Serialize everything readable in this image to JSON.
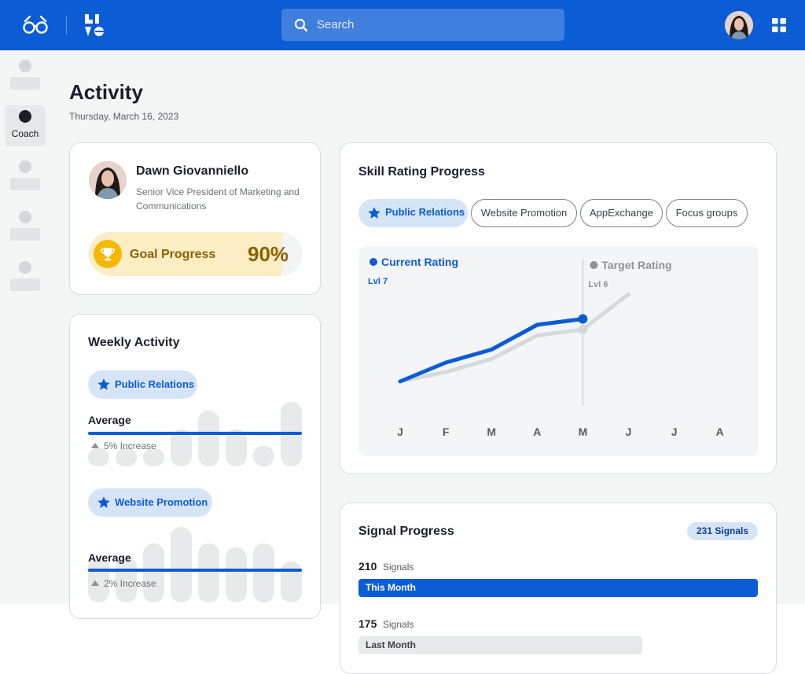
{
  "header": {
    "search_placeholder": "Search",
    "brand_color": "#0b5cd5",
    "icons": [
      "glasses-logo-icon",
      "live-logo-icon",
      "search-icon",
      "apps-grid-icon"
    ]
  },
  "sidebar": {
    "items": [
      {
        "label": ""
      },
      {
        "label": "Coach",
        "active": true
      },
      {
        "label": ""
      },
      {
        "label": ""
      },
      {
        "label": ""
      }
    ]
  },
  "page": {
    "title": "Activity",
    "date": "Thursday, March 16, 2023"
  },
  "profile": {
    "name": "Dawn Giovanniello",
    "role": "Senior Vice President of Marketing and Communications",
    "goal_label": "Goal Progress",
    "goal_value": "90%",
    "goal_fraction": 0.9,
    "goal_color": "#f5b800"
  },
  "weekly": {
    "title": "Weekly Activity",
    "sections": [
      {
        "chip": "Public Relations",
        "average_label": "Average",
        "change": "5% Increase",
        "bars": [
          0.28,
          0.28,
          0.28,
          0.57,
          0.87,
          0.57,
          0.32,
          1.0
        ],
        "average_level": 0.53
      },
      {
        "chip": "Website Promotion",
        "average_label": "Average",
        "change": "2% Increase",
        "bars": [
          0.6,
          0.6,
          0.78,
          1.0,
          0.78,
          0.73,
          0.78,
          0.54
        ],
        "average_level": 0.43
      }
    ]
  },
  "skill": {
    "title": "Skill Rating Progress",
    "tabs": [
      "Public Relations",
      "Website Promotion",
      "AppExchange",
      "Focus groups"
    ],
    "active_tab": 0
  },
  "chart_data": {
    "type": "line",
    "categories": [
      "J",
      "F",
      "M",
      "A",
      "M",
      "J",
      "J",
      "A"
    ],
    "series": [
      {
        "name": "Current Rating",
        "level_label": "Lvl 7",
        "color": "#0b5cd5",
        "values": [
          1.0,
          2.6,
          3.7,
          5.8
        ]
      },
      {
        "name": "Target Rating",
        "level_label": "Lvl 6",
        "color": "#d6d8db",
        "values": [
          1.0,
          1.8,
          2.9,
          4.9,
          5.4,
          8.4
        ]
      }
    ],
    "ylim": [
      0,
      10
    ],
    "grid": false,
    "current_month_index": 4
  },
  "signals": {
    "title": "Signal Progress",
    "badge": "231 Signals",
    "rows": [
      {
        "count": "210",
        "unit": "Signals",
        "label": "This Month",
        "fraction": 1.0
      },
      {
        "count": "175",
        "unit": "Signals",
        "label": "Last Month",
        "fraction": 0.71
      }
    ]
  }
}
